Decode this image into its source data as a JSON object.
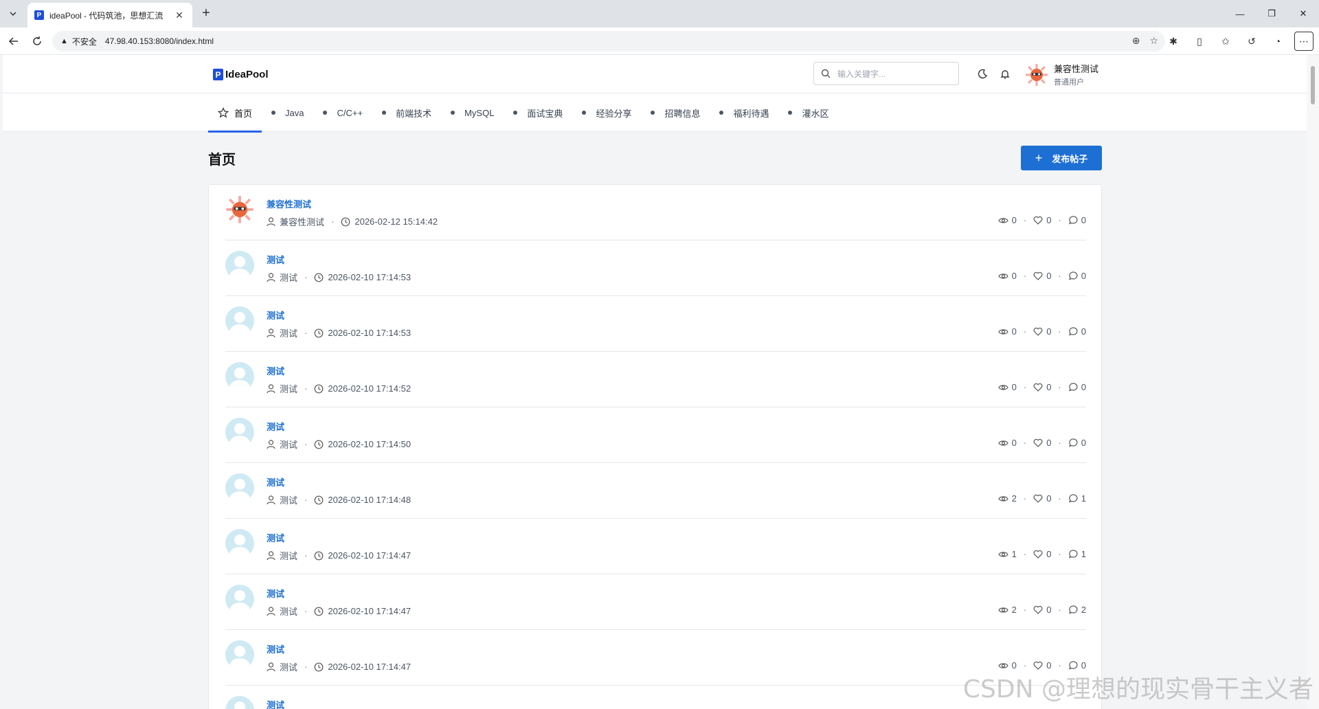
{
  "browser": {
    "tab_title": "ideaPool - 代码筑池，思想汇流",
    "insecure_label": "不安全",
    "url": "47.98.40.153:8080/index.html"
  },
  "header": {
    "logo_text": "IdeaPool",
    "search_placeholder": "输入关键字...",
    "user_name": "兼容性测试",
    "user_role": "普通用户"
  },
  "nav": {
    "items": [
      "首页",
      "Java",
      "C/C++",
      "前端技术",
      "MySQL",
      "面试宝典",
      "经验分享",
      "招聘信息",
      "福利待遇",
      "灌水区"
    ],
    "active": "首页"
  },
  "page": {
    "title": "首页",
    "publish_label": "发布帖子"
  },
  "posts": [
    {
      "title": "兼容性测试",
      "author": "兼容性测试",
      "time": "2026-02-12 15:14:42",
      "views": "0",
      "likes": "0",
      "comments": "0",
      "avatar": "mascot"
    },
    {
      "title": "测试",
      "author": "测试",
      "time": "2026-02-10 17:14:53",
      "views": "0",
      "likes": "0",
      "comments": "0",
      "avatar": "default"
    },
    {
      "title": "测试",
      "author": "测试",
      "time": "2026-02-10 17:14:53",
      "views": "0",
      "likes": "0",
      "comments": "0",
      "avatar": "default"
    },
    {
      "title": "测试",
      "author": "测试",
      "time": "2026-02-10 17:14:52",
      "views": "0",
      "likes": "0",
      "comments": "0",
      "avatar": "default"
    },
    {
      "title": "测试",
      "author": "测试",
      "time": "2026-02-10 17:14:50",
      "views": "0",
      "likes": "0",
      "comments": "0",
      "avatar": "default"
    },
    {
      "title": "测试",
      "author": "测试",
      "time": "2026-02-10 17:14:48",
      "views": "2",
      "likes": "0",
      "comments": "1",
      "avatar": "default"
    },
    {
      "title": "测试",
      "author": "测试",
      "time": "2026-02-10 17:14:47",
      "views": "1",
      "likes": "0",
      "comments": "1",
      "avatar": "default"
    },
    {
      "title": "测试",
      "author": "测试",
      "time": "2026-02-10 17:14:47",
      "views": "2",
      "likes": "0",
      "comments": "2",
      "avatar": "default"
    },
    {
      "title": "测试",
      "author": "测试",
      "time": "2026-02-10 17:14:47",
      "views": "0",
      "likes": "0",
      "comments": "0",
      "avatar": "default"
    },
    {
      "title": "测试",
      "author": "",
      "time": "",
      "views": "",
      "likes": "",
      "comments": "",
      "avatar": "default"
    }
  ],
  "watermark": "CSDN @理想的现实骨干主义者",
  "colors": {
    "accent": "#1d6fd3",
    "nav_active": "#2563eb"
  }
}
